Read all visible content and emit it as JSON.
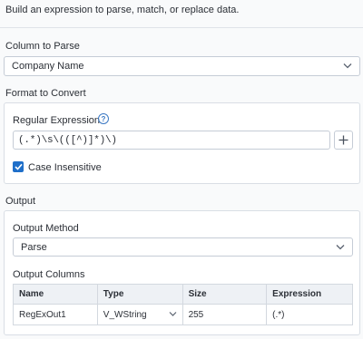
{
  "description": "Build an expression to parse, match, or replace data.",
  "column_to_parse": {
    "label": "Column to Parse",
    "value": "Company Name"
  },
  "format_to_convert": {
    "label": "Format to Convert",
    "regex_label": "Regular Expression",
    "regex_value": "(.*)\\s\\(([^)]*)\\)",
    "case_insensitive_label": "Case Insensitive",
    "case_insensitive_checked": true
  },
  "output": {
    "label": "Output",
    "method_label": "Output Method",
    "method_value": "Parse",
    "columns_label": "Output Columns",
    "columns": {
      "headers": [
        "Name",
        "Type",
        "Size",
        "Expression"
      ],
      "rows": [
        {
          "name": "RegExOut1",
          "type": "V_WString",
          "size": "255",
          "expression": "(.*)"
        }
      ]
    }
  },
  "colors": {
    "accent": "#1f6fc9",
    "background": "#f9fafb"
  },
  "icons": [
    "chevron-down-icon",
    "help-icon",
    "plus-icon",
    "checkmark-icon"
  ]
}
